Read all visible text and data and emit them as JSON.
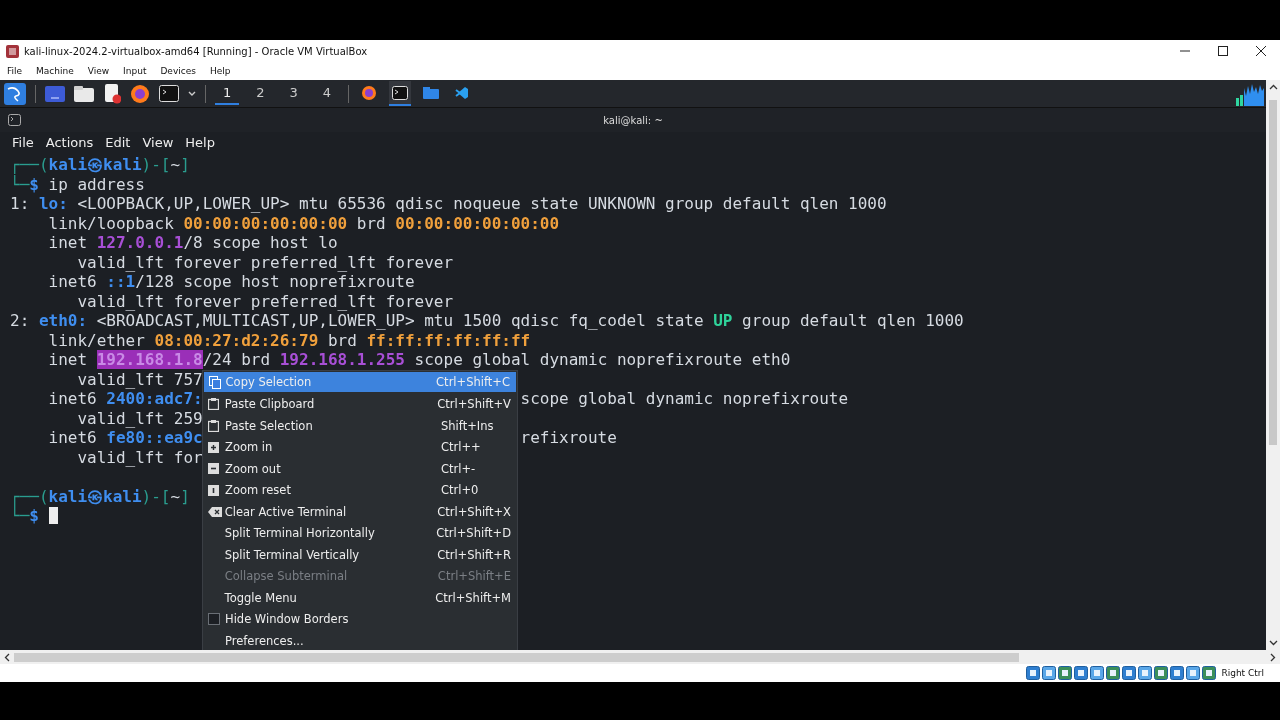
{
  "host_window": {
    "title": "kali-linux-2024.2-virtualbox-amd64 [Running] - Oracle VM VirtualBox",
    "menu": [
      "File",
      "Machine",
      "View",
      "Input",
      "Devices",
      "Help"
    ]
  },
  "panel": {
    "launchers": [
      {
        "kind": "desktop"
      },
      {
        "kind": "files"
      },
      {
        "kind": "editor"
      },
      {
        "kind": "browser"
      },
      {
        "kind": "terminal"
      }
    ],
    "workspaces": [
      {
        "label": "1",
        "selected": true
      },
      {
        "label": "2",
        "selected": false
      },
      {
        "label": "3",
        "selected": false
      },
      {
        "label": "4",
        "selected": false
      }
    ],
    "tasks": [
      {
        "kind": "browser",
        "selected": false
      },
      {
        "kind": "terminal",
        "selected": true
      },
      {
        "kind": "folder",
        "selected": false
      },
      {
        "kind": "code",
        "selected": false
      }
    ]
  },
  "terminal": {
    "title": "kali@kali: ~",
    "menu": [
      "File",
      "Actions",
      "Edit",
      "View",
      "Help"
    ],
    "lines": [
      {
        "kind": "text",
        "left": [
          {
            "kind": "frame",
            "t": "┌──("
          },
          {
            "kind": "host",
            "t": "kali㉿kali"
          },
          {
            "kind": "frame",
            "t": ")-["
          },
          {
            "kind": "plain",
            "t": "~"
          },
          {
            "kind": "frame",
            "t": "]"
          }
        ]
      },
      {
        "kind": "text",
        "left": [
          {
            "kind": "frame",
            "t": "└─"
          },
          {
            "kind": "host",
            "t": "$"
          },
          {
            "kind": "plain",
            "t": " ip address"
          }
        ]
      },
      {
        "kind": "text",
        "left": [
          {
            "kind": "plain",
            "t": "1: "
          },
          {
            "kind": "host",
            "t": "lo:"
          },
          {
            "kind": "plain",
            "t": " <LOOPBACK,UP,LOWER_UP> mtu 65536 qdisc noqueue state UNKNOWN group default qlen 1000"
          }
        ]
      },
      {
        "kind": "text",
        "left": [
          {
            "kind": "plain",
            "t": "    link/loopback "
          },
          {
            "kind": "mac",
            "t": "00:00:00:00:00:00"
          },
          {
            "kind": "plain",
            "t": " brd "
          },
          {
            "kind": "mac",
            "t": "00:00:00:00:00:00"
          }
        ]
      },
      {
        "kind": "text",
        "left": [
          {
            "kind": "plain",
            "t": "    inet "
          },
          {
            "kind": "ip",
            "t": "127.0.0.1"
          },
          {
            "kind": "plain",
            "t": "/8 scope host lo"
          }
        ]
      },
      {
        "kind": "text",
        "left": [
          {
            "kind": "plain",
            "t": "       valid_lft forever preferred_lft forever"
          }
        ]
      },
      {
        "kind": "text",
        "left": [
          {
            "kind": "plain",
            "t": "    inet6 "
          },
          {
            "kind": "ip6",
            "t": "::1"
          },
          {
            "kind": "plain",
            "t": "/128 scope host noprefixroute"
          }
        ]
      },
      {
        "kind": "text",
        "left": [
          {
            "kind": "plain",
            "t": "       valid_lft forever preferred_lft forever"
          }
        ]
      },
      {
        "kind": "text",
        "left": [
          {
            "kind": "plain",
            "t": "2: "
          },
          {
            "kind": "host",
            "t": "eth0:"
          },
          {
            "kind": "plain",
            "t": " <BROADCAST,MULTICAST,UP,LOWER_UP> mtu 1500 qdisc fq_codel state "
          },
          {
            "kind": "state",
            "t": "UP"
          },
          {
            "kind": "plain",
            "t": " group default qlen 1000"
          }
        ]
      },
      {
        "kind": "text",
        "left": [
          {
            "kind": "plain",
            "t": "    link/ether "
          },
          {
            "kind": "mac",
            "t": "08:00:27:d2:26:79"
          },
          {
            "kind": "plain",
            "t": " brd "
          },
          {
            "kind": "mac",
            "t": "ff:ff:ff:ff:ff:ff"
          }
        ]
      },
      {
        "kind": "text",
        "left": [
          {
            "kind": "plain",
            "t": "    inet "
          },
          {
            "kind": "selected",
            "t": "192.168.1.8"
          },
          {
            "kind": "plain",
            "t": "/24 brd "
          },
          {
            "kind": "ip",
            "t": "192.168.1.255"
          },
          {
            "kind": "plain",
            "t": " scope global dynamic noprefixroute eth0"
          }
        ]
      },
      {
        "kind": "text",
        "left": [
          {
            "kind": "plain",
            "t": "       valid_lft 757"
          }
        ]
      },
      {
        "kind": "text",
        "left": [
          {
            "kind": "plain",
            "t": "    inet6 "
          },
          {
            "kind": "ip6",
            "t": "2400:adc7:"
          }
        ],
        "right": "scope global dynamic noprefixroute"
      },
      {
        "kind": "text",
        "left": [
          {
            "kind": "plain",
            "t": "       valid_lft 259"
          }
        ]
      },
      {
        "kind": "text",
        "left": [
          {
            "kind": "plain",
            "t": "    inet6 "
          },
          {
            "kind": "ip6",
            "t": "fe80::ea9c"
          }
        ],
        "right": "refixroute"
      },
      {
        "kind": "text",
        "left": [
          {
            "kind": "plain",
            "t": "       valid_lft for"
          }
        ]
      },
      {
        "kind": "blank"
      },
      {
        "kind": "text",
        "left": [
          {
            "kind": "frame",
            "t": "┌──("
          },
          {
            "kind": "host",
            "t": "kali㉿kali"
          },
          {
            "kind": "frame",
            "t": ")-["
          },
          {
            "kind": "plain",
            "t": "~"
          },
          {
            "kind": "frame",
            "t": "]"
          }
        ]
      },
      {
        "kind": "text",
        "left": [
          {
            "kind": "frame",
            "t": "└─"
          },
          {
            "kind": "host",
            "t": "$"
          }
        ],
        "cursor": true
      }
    ]
  },
  "context_menu": [
    {
      "kind": "copy",
      "label": "Copy Selection",
      "shortcut": "Ctrl+Shift+C",
      "selected": true,
      "disabled": false
    },
    {
      "kind": "paste",
      "label": "Paste Clipboard",
      "shortcut": "Ctrl+Shift+V",
      "selected": false,
      "disabled": false
    },
    {
      "kind": "paste",
      "label": "Paste Selection",
      "shortcut": "Shift+Ins",
      "selected": false,
      "disabled": false
    },
    {
      "kind": "zoom-in",
      "label": "Zoom in",
      "shortcut": "Ctrl++",
      "selected": false,
      "disabled": false
    },
    {
      "kind": "zoom-out",
      "label": "Zoom out",
      "shortcut": "Ctrl+-",
      "selected": false,
      "disabled": false
    },
    {
      "kind": "zoom-reset",
      "label": "Zoom reset",
      "shortcut": "Ctrl+0",
      "selected": false,
      "disabled": false
    },
    {
      "kind": "clear",
      "label": "Clear Active Terminal",
      "shortcut": "Ctrl+Shift+X",
      "selected": false,
      "disabled": false
    },
    {
      "kind": "plain",
      "label": "Split Terminal Horizontally",
      "shortcut": "Ctrl+Shift+D",
      "selected": false,
      "disabled": false
    },
    {
      "kind": "plain",
      "label": "Split Terminal Vertically",
      "shortcut": "Ctrl+Shift+R",
      "selected": false,
      "disabled": false
    },
    {
      "kind": "plain",
      "label": "Collapse Subterminal",
      "shortcut": "Ctrl+Shift+E",
      "selected": false,
      "disabled": true
    },
    {
      "kind": "plain",
      "label": "Toggle Menu",
      "shortcut": "Ctrl+Shift+M",
      "selected": false,
      "disabled": false
    },
    {
      "kind": "check",
      "checked": false,
      "label": "Hide Window Borders",
      "selected": false,
      "disabled": false
    },
    {
      "kind": "plain",
      "label": "Preferences...",
      "selected": false,
      "disabled": false
    }
  ],
  "status_bar": {
    "label": "Right Ctrl"
  }
}
